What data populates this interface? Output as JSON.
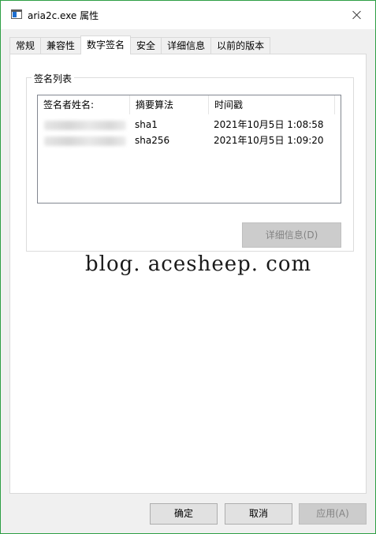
{
  "window": {
    "title": "aria2c.exe 属性",
    "close_icon": "close-icon",
    "app_icon": "app-window-icon"
  },
  "tabs": [
    {
      "label": "常规",
      "active": false
    },
    {
      "label": "兼容性",
      "active": false
    },
    {
      "label": "数字签名",
      "active": true
    },
    {
      "label": "安全",
      "active": false
    },
    {
      "label": "详细信息",
      "active": false
    },
    {
      "label": "以前的版本",
      "active": false
    }
  ],
  "signature_group": {
    "title": "签名列表",
    "columns": [
      "签名者姓名:",
      "摘要算法",
      "时间戳"
    ],
    "rows": [
      {
        "name": "",
        "algorithm": "sha1",
        "timestamp": "2021年10月5日 1:08:58"
      },
      {
        "name": "",
        "algorithm": "sha256",
        "timestamp": "2021年10月5日 1:09:20"
      }
    ],
    "details_button": "详细信息(D)"
  },
  "watermark": "blog. acesheep. com",
  "buttons": {
    "ok": "确定",
    "cancel": "取消",
    "apply": "应用(A)"
  },
  "colors": {
    "window_border": "#2e9e44",
    "disabled_text": "#838383"
  }
}
